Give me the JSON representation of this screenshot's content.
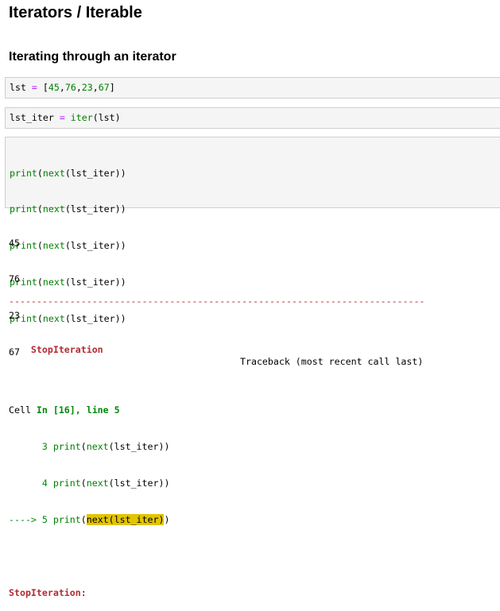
{
  "heading": "Iterators / Iterable",
  "subheading": "Iterating through an iterator",
  "cell1": {
    "var": "lst",
    "op": " = ",
    "bracket_open": "[",
    "n1": "45",
    "n2": "76",
    "n3": "23",
    "n4": "67",
    "comma": ",",
    "bracket_close": "]"
  },
  "cell2": {
    "var": "lst_iter",
    "op": " = ",
    "fn": "iter",
    "arg": "(lst)"
  },
  "cell3": {
    "lines": [
      {
        "print": "print",
        "mid": "(",
        "next": "next",
        "rest": "(lst_iter))"
      },
      {
        "print": "print",
        "mid": "(",
        "next": "next",
        "rest": "(lst_iter))"
      },
      {
        "print": "print",
        "mid": "(",
        "next": "next",
        "rest": "(lst_iter))"
      },
      {
        "print": "print",
        "mid": "(",
        "next": "next",
        "rest": "(lst_iter))"
      },
      {
        "print": "print",
        "mid": "(",
        "next": "next",
        "rest": "(lst_iter))"
      }
    ]
  },
  "outputs": [
    "45",
    "76",
    "23",
    "67"
  ],
  "traceback": {
    "dashes": "---------------------------------------------------------------------------",
    "error_name": "StopIteration",
    "header_right": "Traceback (most recent call last)",
    "cell_prefix": "Cell ",
    "cell_in": "In [16], line 5",
    "line3_num": "      3 ",
    "line4_num": "      4 ",
    "arrow": "----> 5 ",
    "code_print": "print",
    "code_open": "(",
    "code_next": "next",
    "code_rest": "(lst_iter))",
    "hl_text": "next(lst_iter)",
    "hl_tail": ")",
    "final_error": "StopIteration",
    "final_colon": ":"
  }
}
